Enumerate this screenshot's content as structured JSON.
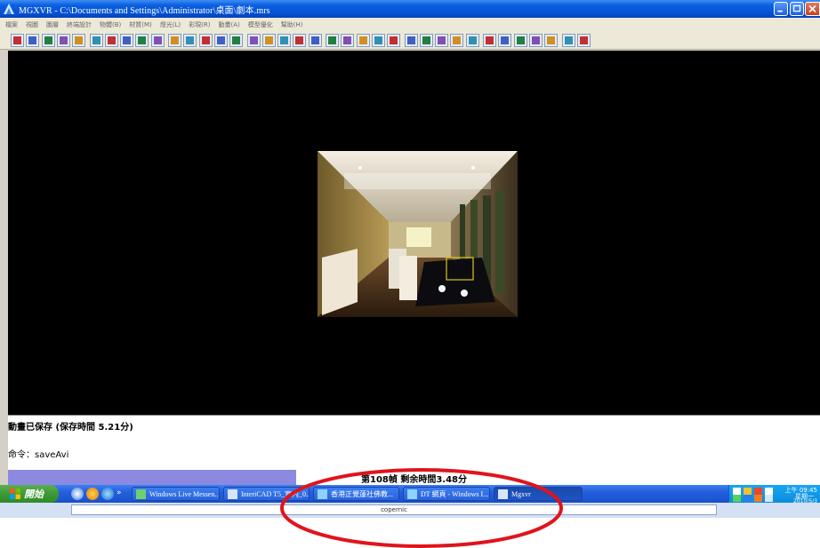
{
  "window": {
    "title": "MGXVR - C:\\Documents and Settings\\Administrator\\桌面\\劇本.mrs",
    "app_icon": "mgxvr-app-icon"
  },
  "menu": [
    "檔案",
    "視圖",
    "圖層",
    "終端設計",
    "物體(B)",
    "材質(M)",
    "燈光(L)",
    "彩現(R)",
    "動畫(A)",
    "模型優化",
    "幫助(H)"
  ],
  "toolbar": {
    "buttons": [
      "select-icon",
      "deselect-icon",
      "stop-icon",
      "prev-frame-icon",
      "play-icon",
      "next-frame-icon",
      "record-icon",
      "camera-icon",
      "view-front-icon",
      "view-back-icon",
      "first-key-icon",
      "key-icon",
      "last-key-icon",
      "loop-icon",
      "target-icon",
      "orbit-icon",
      "grid-icon",
      "light-icon",
      "texture-icon",
      "material-icon",
      "select-arrow-icon",
      "object-icon",
      "walk-icon",
      "mountain-icon",
      "triangle-icon",
      "plane-icon",
      "cursor-icon",
      "pan-icon",
      "zoom-icon",
      "window-1-icon",
      "window-2-icon",
      "window-3-icon",
      "window-4-icon",
      "sphere-icon",
      "magnify-icon",
      "layout-icon",
      "window-icon"
    ]
  },
  "console": {
    "line1": "動畫已保存 (保存時間 5.21分)",
    "line2": "命令：saveAvi"
  },
  "progress": {
    "text": "第108幀 剩余時間3.48分",
    "fraction": 0.355
  },
  "taskbar": {
    "start_label": "開始",
    "quick_launch": [
      "desktop-icon",
      "media-icon",
      "ie-icon"
    ],
    "chevron": "»",
    "tasks": [
      {
        "label": "Windows Live Messen...",
        "icon": "messenger-icon",
        "active": false
      },
      {
        "label": "InteriCAD T5_室內_0...",
        "icon": "intericad-icon",
        "active": false
      },
      {
        "label": "香港正覺蓮社佛教...",
        "icon": "ie-icon",
        "active": false
      },
      {
        "label": "DT 網頁 - Windows I...",
        "icon": "ie-icon",
        "active": false
      },
      {
        "label": "Mgxvr",
        "icon": "mgxvr-icon",
        "active": true
      }
    ],
    "tray": {
      "time": "上午 09:45",
      "day": "星期一",
      "date": "2010/5/3"
    }
  },
  "search": {
    "brand": "copernic"
  },
  "colors": {
    "titlebar": "#0653d8",
    "progress_fill": "#8b8ae0",
    "annotation": "#e0141c",
    "viewport": "#000000"
  }
}
